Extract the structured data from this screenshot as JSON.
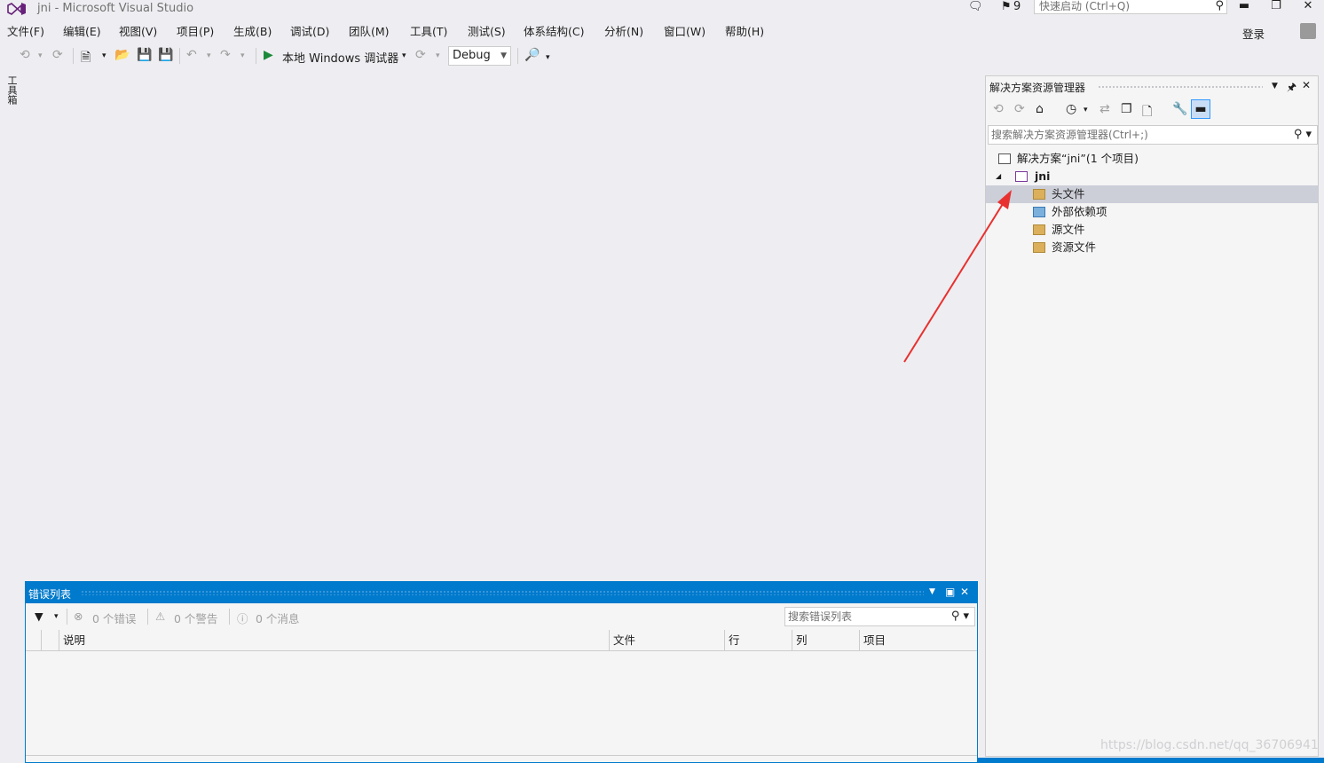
{
  "titlebar": {
    "title": "jni - Microsoft Visual Studio",
    "notification_count": "9",
    "quick_launch_placeholder": "快速启动 (Ctrl+Q)"
  },
  "menu": {
    "items": [
      "文件(F)",
      "编辑(E)",
      "视图(V)",
      "项目(P)",
      "生成(B)",
      "调试(D)",
      "团队(M)",
      "工具(T)",
      "测试(S)",
      "体系结构(C)",
      "分析(N)",
      "窗口(W)",
      "帮助(H)"
    ],
    "login": "登录"
  },
  "toolbar": {
    "run_label": "本地 Windows 调试器",
    "configuration": "Debug"
  },
  "toolbox_tab": "工具箱",
  "solution_explorer": {
    "title": "解决方案资源管理器",
    "search_placeholder": "搜索解决方案资源管理器(Ctrl+;)",
    "tree": {
      "solution": "解决方案“jni”(1 个项目)",
      "project": "jni",
      "children": [
        "头文件",
        "外部依赖项",
        "源文件",
        "资源文件"
      ]
    }
  },
  "error_list": {
    "title": "错误列表",
    "errors": "0 个错误",
    "warnings": "0 个警告",
    "messages": "0 个消息",
    "search_placeholder": "搜索错误列表",
    "columns": [
      "说明",
      "文件",
      "行",
      "列",
      "项目"
    ]
  },
  "watermark": "https://blog.csdn.net/qq_36706941",
  "colors": {
    "accent": "#007acc",
    "annotation_arrow": "#e8312f",
    "selection": "#ccced8"
  }
}
